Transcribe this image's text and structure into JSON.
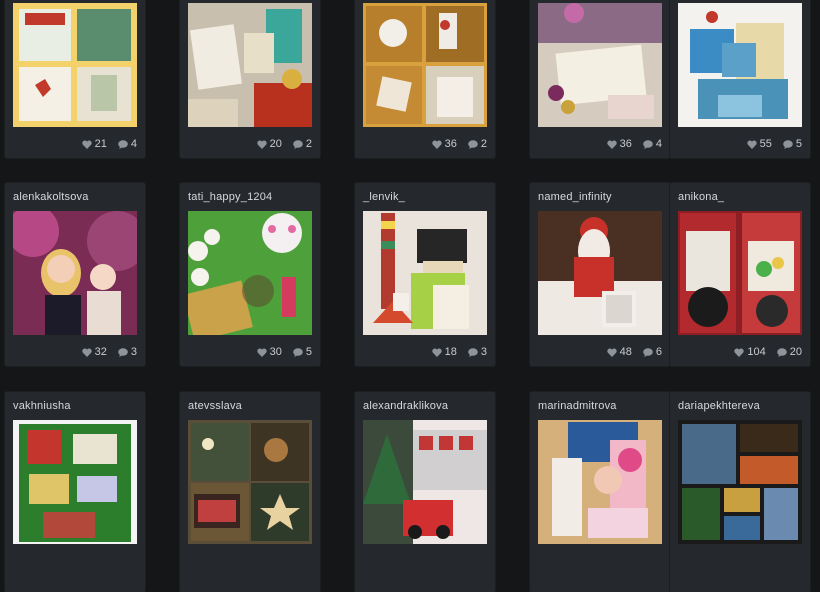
{
  "cards": [
    {
      "user": "",
      "likes": "21",
      "comments": "4"
    },
    {
      "user": "",
      "likes": "20",
      "comments": "2"
    },
    {
      "user": "",
      "likes": "36",
      "comments": "2"
    },
    {
      "user": "",
      "likes": "36",
      "comments": "4"
    },
    {
      "user": "",
      "likes": "55",
      "comments": "5"
    },
    {
      "user": "alenkakoltsova",
      "likes": "32",
      "comments": "3"
    },
    {
      "user": "tati_happy_1204",
      "likes": "30",
      "comments": "5"
    },
    {
      "user": "_lenvik_",
      "likes": "18",
      "comments": "3"
    },
    {
      "user": "named_infinity",
      "likes": "48",
      "comments": "6"
    },
    {
      "user": "anikona_",
      "likes": "104",
      "comments": "20"
    },
    {
      "user": "vakhniusha",
      "likes": "",
      "comments": ""
    },
    {
      "user": "atevsslava",
      "likes": "",
      "comments": ""
    },
    {
      "user": "alexandraklikova",
      "likes": "",
      "comments": ""
    },
    {
      "user": "marinadmitrova",
      "likes": "",
      "comments": ""
    },
    {
      "user": "dariapekhtereva",
      "likes": "",
      "comments": ""
    }
  ],
  "icons": {
    "like": "heart-icon",
    "comment": "speech-bubble-icon"
  },
  "colors": {
    "background": "#141618",
    "card": "#25292d",
    "text": "#d6d9dc",
    "icon": "#8e9499"
  }
}
